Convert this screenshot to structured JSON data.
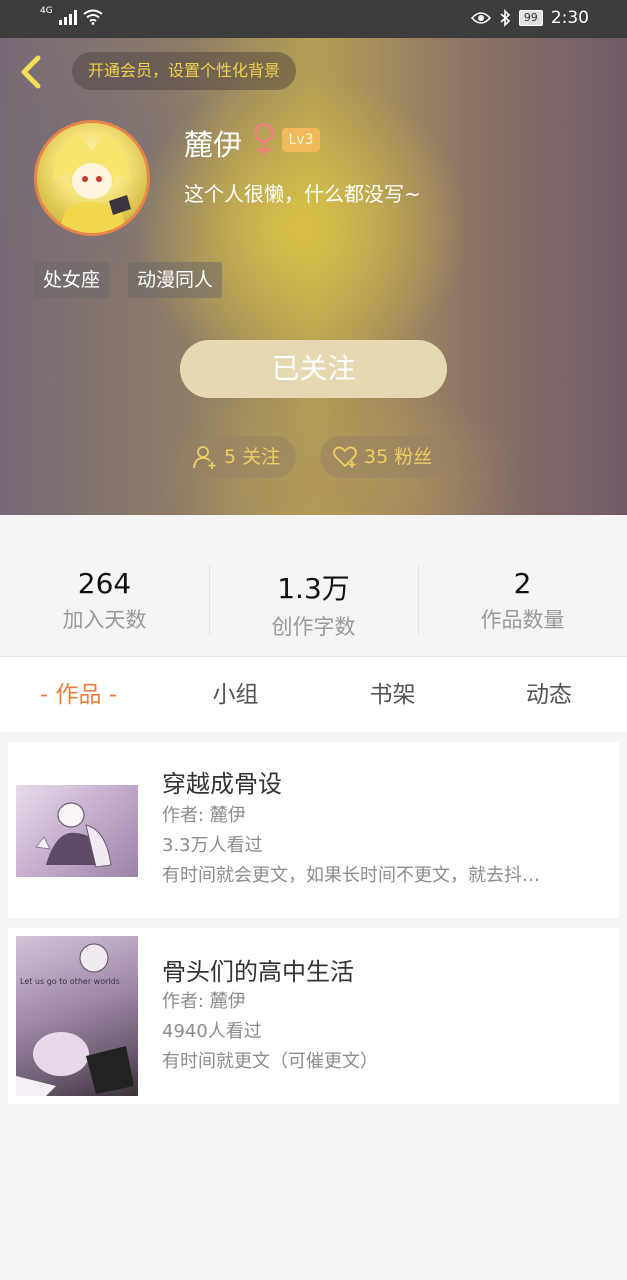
{
  "status_bar": {
    "network": "4G",
    "battery": "99",
    "time": "2:30"
  },
  "header": {
    "vip_prompt": "开通会员，设置个性化背景",
    "nickname": "麓伊",
    "level": "Lv3",
    "bio": "这个人很懒，什么都没写~",
    "tags": [
      "处女座",
      "动漫同人"
    ],
    "follow_button": "已关注",
    "following": "5 关注",
    "fans": "35 粉丝",
    "accent_color": "#f0cf65"
  },
  "stats": [
    {
      "value": "264",
      "label": "加入天数"
    },
    {
      "value": "1.3万",
      "label": "创作字数"
    },
    {
      "value": "2",
      "label": "作品数量"
    }
  ],
  "tabs": {
    "active_color": "#f07d3c",
    "items": [
      "- 作品 -",
      "小组",
      "书架",
      "动态"
    ]
  },
  "works": [
    {
      "title": "穿越成骨设",
      "author": "作者: 麓伊",
      "views": "3.3万人看过",
      "description": "有时间就会更文，如果长时间不更文，就去抖…"
    },
    {
      "title": "骨头们的高中生活",
      "author": "作者: 麓伊",
      "views": "4940人看过",
      "description": "有时间就更文（可催更文）",
      "cover_text": "Let us go to other worlds"
    }
  ]
}
